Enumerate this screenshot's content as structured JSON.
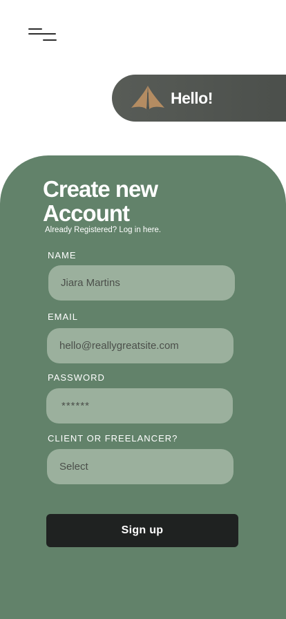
{
  "header": {
    "greeting": "Hello!"
  },
  "form": {
    "title_line1": "Create new",
    "title_line2": "Account",
    "login_prompt": "Already Registered? Log in here.",
    "name_label": "NAME",
    "name_value": "Jiara Martins",
    "email_label": "EMAIL",
    "email_value": "hello@reallygreatsite.com",
    "password_label": "PASSWORD",
    "password_value": "******",
    "role_label": "CLIENT OR FREELANCER?",
    "role_value": "Select",
    "submit_label": "Sign up"
  },
  "colors": {
    "card": "#62826a",
    "field": "#9bb09d",
    "pill": "#4f534f",
    "logo": "#b48c62",
    "button": "#1f2221"
  },
  "icons": {
    "menu": "hamburger-menu-icon",
    "logo": "leaf-logo-icon"
  }
}
